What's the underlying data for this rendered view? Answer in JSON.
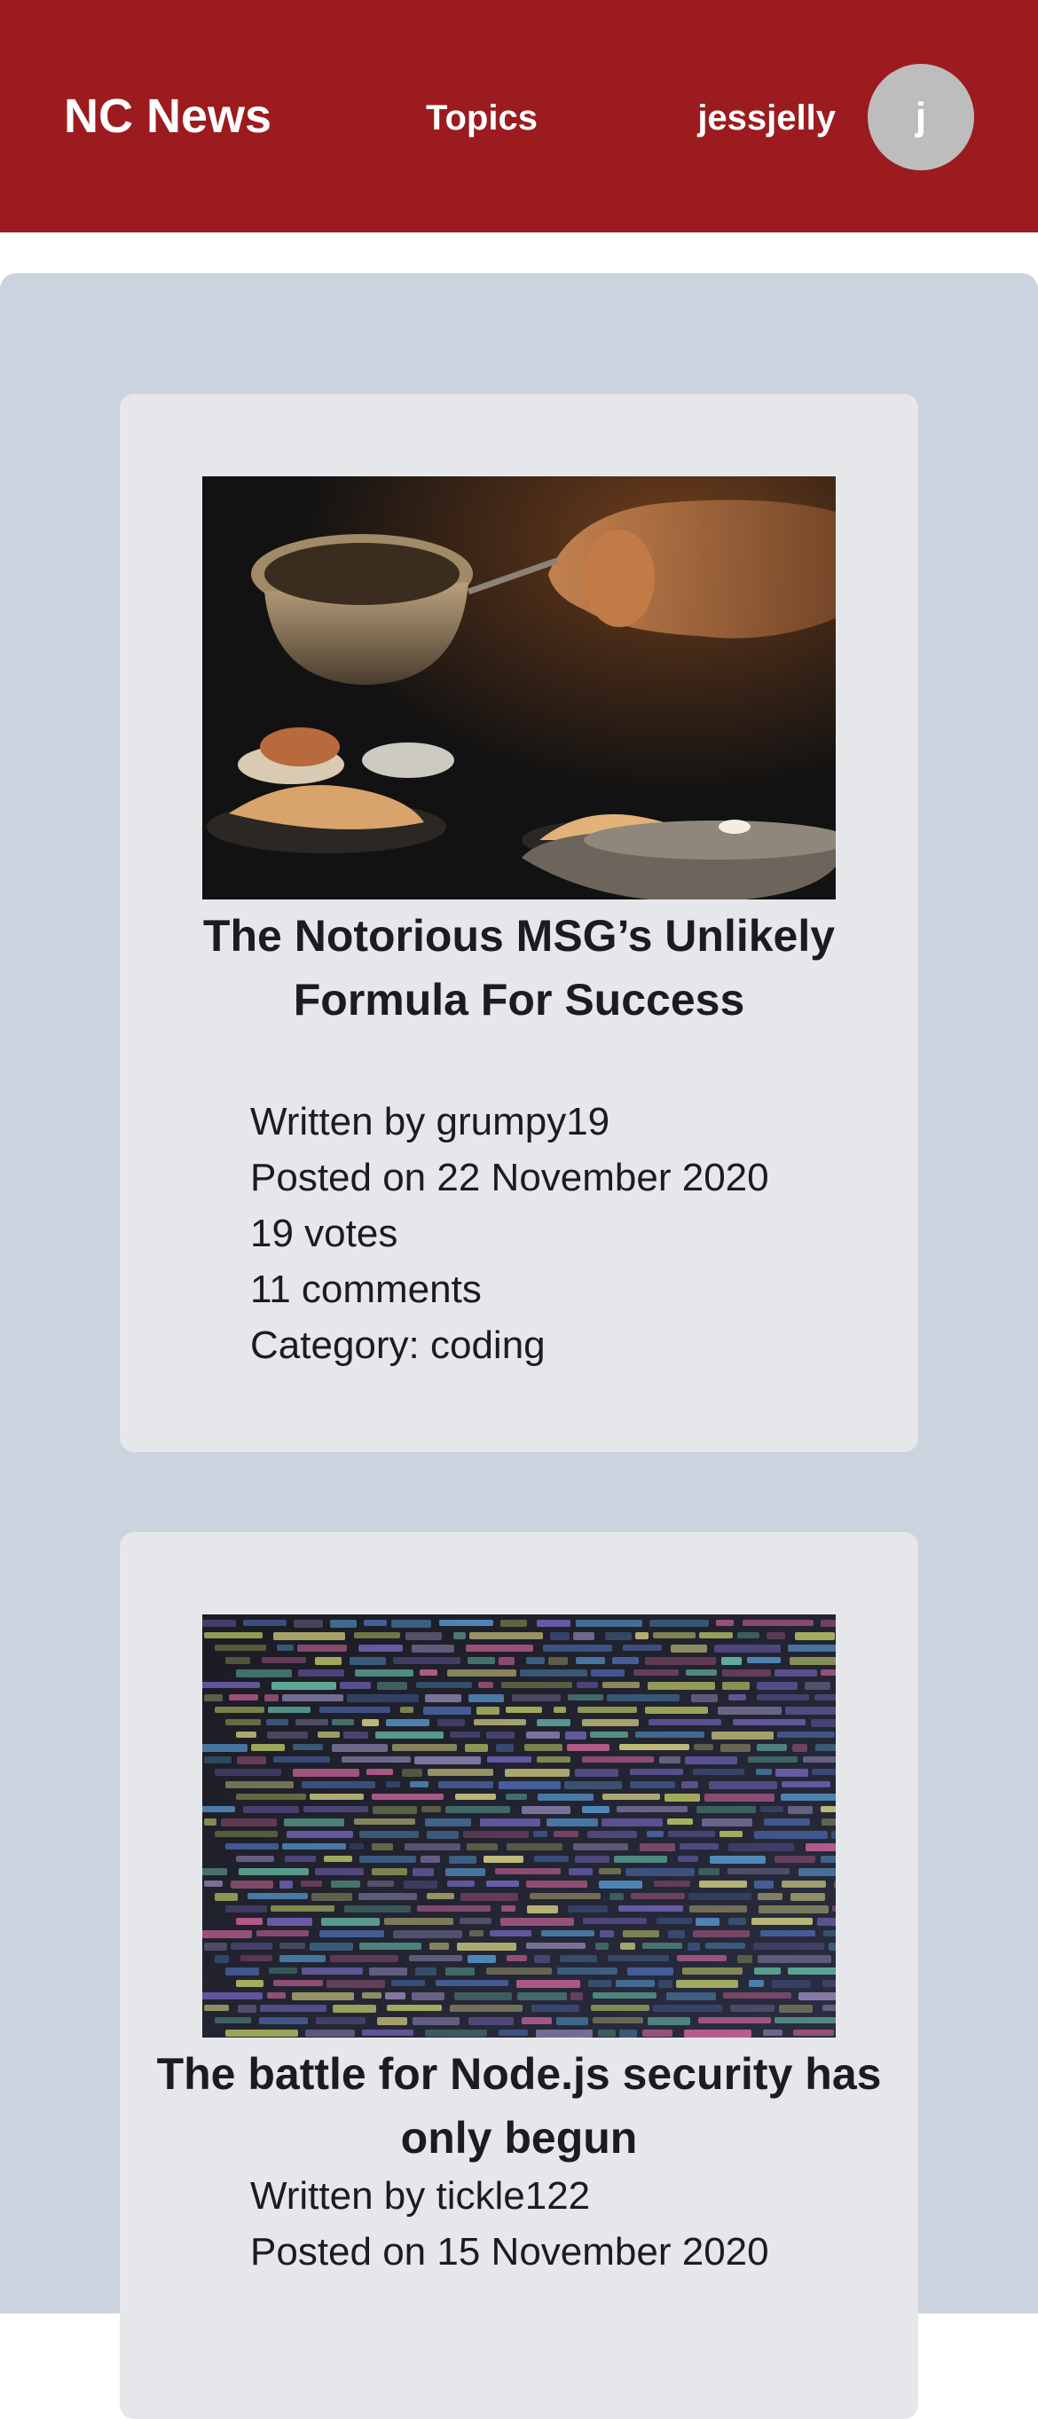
{
  "header": {
    "brand": "NC News",
    "topics_label": "Topics",
    "username": "jessjelly",
    "avatar_initial": "j"
  },
  "articles": [
    {
      "title": "The Notorious MSG’s Unlikely Formula For Success",
      "author_line": "Written by grumpy19",
      "date_line": "Posted on 22 November 2020",
      "votes_line": "19 votes",
      "comments_line": "11 comments",
      "category_line": "Category: coding",
      "image_icon": "food-cooking-photo"
    },
    {
      "title": "The battle for Node.js security has only begun",
      "author_line": "Written by tickle122",
      "date_line": "Posted on 15 November 2020",
      "image_icon": "code-screen-photo"
    }
  ],
  "colors": {
    "header": "#9b1b1e",
    "feed_background": "#cbd3df",
    "card_background": "#e6e7eb",
    "avatar": "#bdbdbd"
  }
}
